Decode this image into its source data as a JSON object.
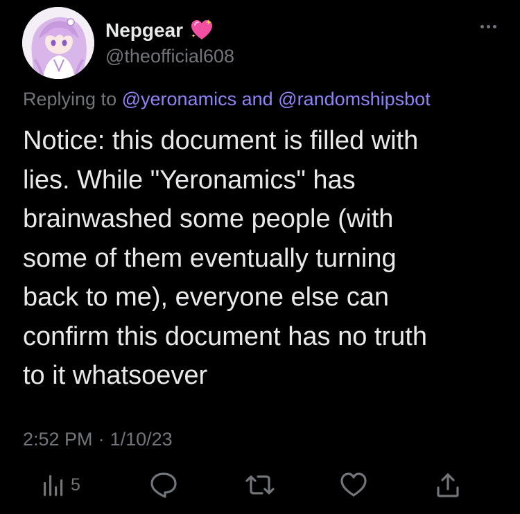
{
  "user": {
    "display_name": "Nepgear",
    "handle": "@theofficial608",
    "name_emoji": "sparkling-heart"
  },
  "reply": {
    "prefix": "Replying to",
    "mention_1": "@yeronamics",
    "conjunction": "and",
    "mention_2": "@randomshipsbot"
  },
  "tweet": {
    "lines": [
      "Notice: this document is filled with",
      "lies. While \"Yeronamics\" has",
      "brainwashed some people (with",
      "some of them eventually turning",
      "back to me), everyone else can",
      "confirm this document has no truth",
      "to it whatsoever"
    ]
  },
  "meta": {
    "time": "2:52 PM",
    "separator": "·",
    "date": "1/10/23"
  },
  "actions": {
    "views_icon": "analytics-icon",
    "views_count": "5",
    "reply_icon": "reply-icon",
    "retweet_icon": "retweet-icon",
    "like_icon": "heart-icon",
    "share_icon": "share-icon"
  },
  "colors": {
    "background": "#000000",
    "text": "#e7e9ea",
    "muted": "#71767b",
    "mention": "#8c84f7"
  }
}
